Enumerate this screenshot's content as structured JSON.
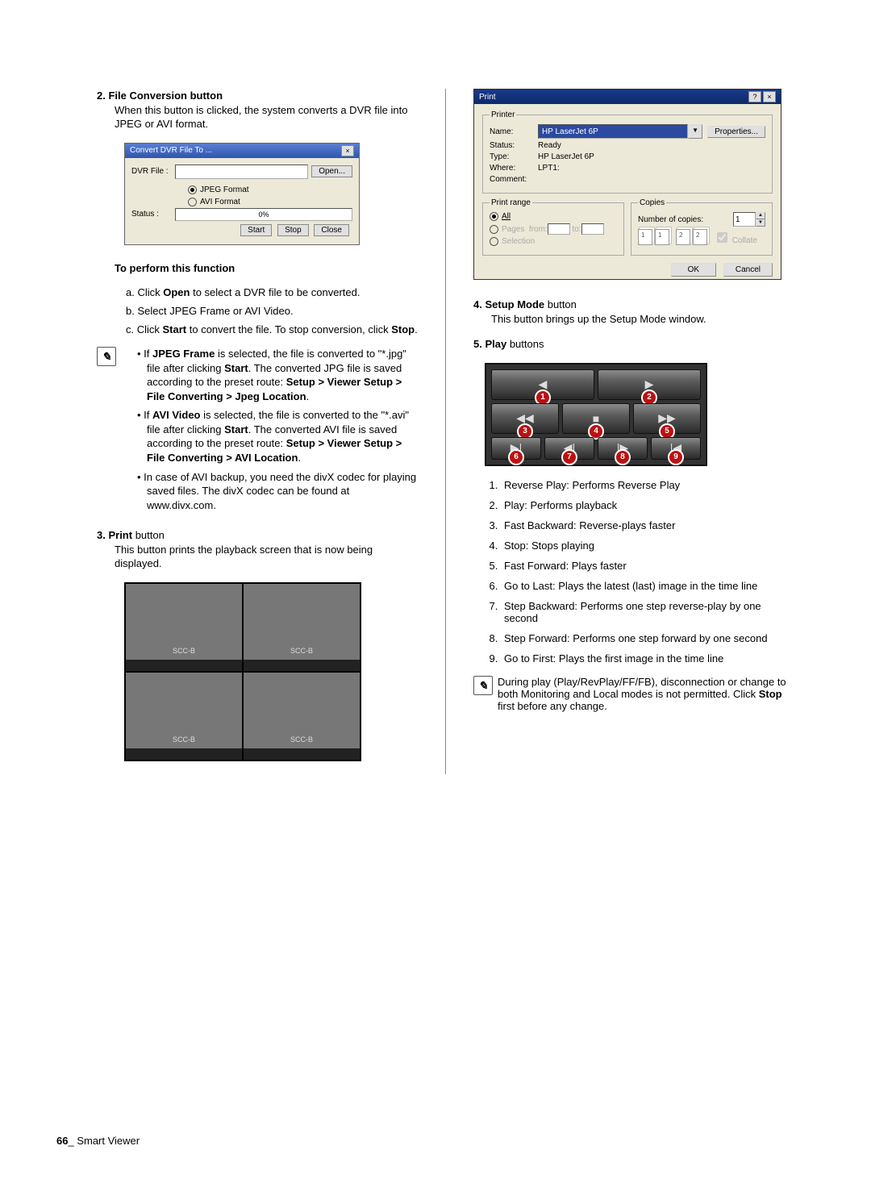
{
  "footer": {
    "page": "66",
    "section": "Smart Viewer"
  },
  "left": {
    "s2": {
      "num": "2.",
      "title": "File Conversion button",
      "desc": "When this button is clicked, the system converts a DVR file into JPEG or AVI format."
    },
    "convert_dlg": {
      "title": "Convert DVR File To ...",
      "file_lbl": "DVR File :",
      "open": "Open...",
      "radio_jpeg": "JPEG Format",
      "radio_avi": "AVI Format",
      "status_lbl": "Status :",
      "progress": "0%",
      "start": "Start",
      "stop": "Stop",
      "close": "Close"
    },
    "perform": {
      "heading": "To perform this function",
      "a_pre": "a.   Click ",
      "a_bold": "Open",
      "a_post": " to select a DVR file to be converted.",
      "b": "b.   Select JPEG Frame or AVI Video.",
      "c_pre": "c.   Click ",
      "c_bold1": "Start",
      "c_mid": " to convert the file. To stop conversion, click ",
      "c_bold2": "Stop",
      "c_end": "."
    },
    "notes": {
      "n1_pre": "If ",
      "n1_b1": "JPEG Frame",
      "n1_mid1": " is selected, the file is converted to \"*.jpg\" file after clicking ",
      "n1_b2": "Start",
      "n1_mid2": ". The converted JPG file is saved according to the preset route: ",
      "n1_b3": "Setup > Viewer Setup > File Converting > Jpeg Location",
      "n1_end": ".",
      "n2_pre": "If ",
      "n2_b1": "AVI Video",
      "n2_mid1": " is selected, the file is converted to the \"*.avi\" file after clicking ",
      "n2_b2": "Start",
      "n2_mid2": ". The converted AVI file is saved according to the preset route: ",
      "n2_b3": "Setup > Viewer Setup > File Converting > AVI Location",
      "n2_end": ".",
      "n3": "In case of AVI backup, you need the divX codec for playing saved files. The divX codec can be found at www.divx.com."
    },
    "s3": {
      "num": "3.",
      "title": "Print",
      "suffix": " button",
      "desc": "This button prints the playback screen that is now being displayed."
    },
    "quad_label": "SCC-B"
  },
  "right": {
    "print_dlg": {
      "title": "Print",
      "printer_legend": "Printer",
      "name_lbl": "Name:",
      "name_val": "HP LaserJet 6P",
      "props": "Properties...",
      "status_lbl": "Status:",
      "status_val": "Ready",
      "type_lbl": "Type:",
      "type_val": "HP LaserJet 6P",
      "where_lbl": "Where:",
      "where_val": "LPT1:",
      "comment_lbl": "Comment:",
      "range_legend": "Print range",
      "all": "All",
      "pages": "Pages",
      "from": "from:",
      "to": "to:",
      "selection": "Selection",
      "copies_legend": "Copies",
      "numcopies": "Number of copies:",
      "copies_val": "1",
      "collate": "Collate",
      "ok": "OK",
      "cancel": "Cancel"
    },
    "s4": {
      "num": "4.",
      "title": "Setup Mode",
      "suffix": " button",
      "desc": "This button brings up the Setup Mode window."
    },
    "s5": {
      "num": "5.",
      "title": "Play",
      "suffix": " buttons"
    },
    "play_glyphs": {
      "rev": "◀",
      "play": "▶",
      "fb": "◀◀",
      "stop": "■",
      "ff": "▶▶",
      "last": "▶|",
      "stepb": "◀|",
      "stepf": "|▶",
      "first": "|◀"
    },
    "play_list": [
      "Reverse Play: Performs Reverse Play",
      "Play: Performs playback",
      "Fast Backward: Reverse-plays faster",
      "Stop: Stops playing",
      "Fast Forward: Plays faster",
      "Go to Last: Plays the latest (last) image in the time line",
      "Step Backward: Performs one step reverse-play by one second",
      "Step Forward: Performs one step forward by one second",
      "Go to First: Plays the first image in the time line"
    ],
    "note2_pre": "During play (Play/RevPlay/FF/FB), disconnection or change to both Monitoring and Local modes is not permitted. Click ",
    "note2_bold": "Stop",
    "note2_post": " first before any change."
  }
}
